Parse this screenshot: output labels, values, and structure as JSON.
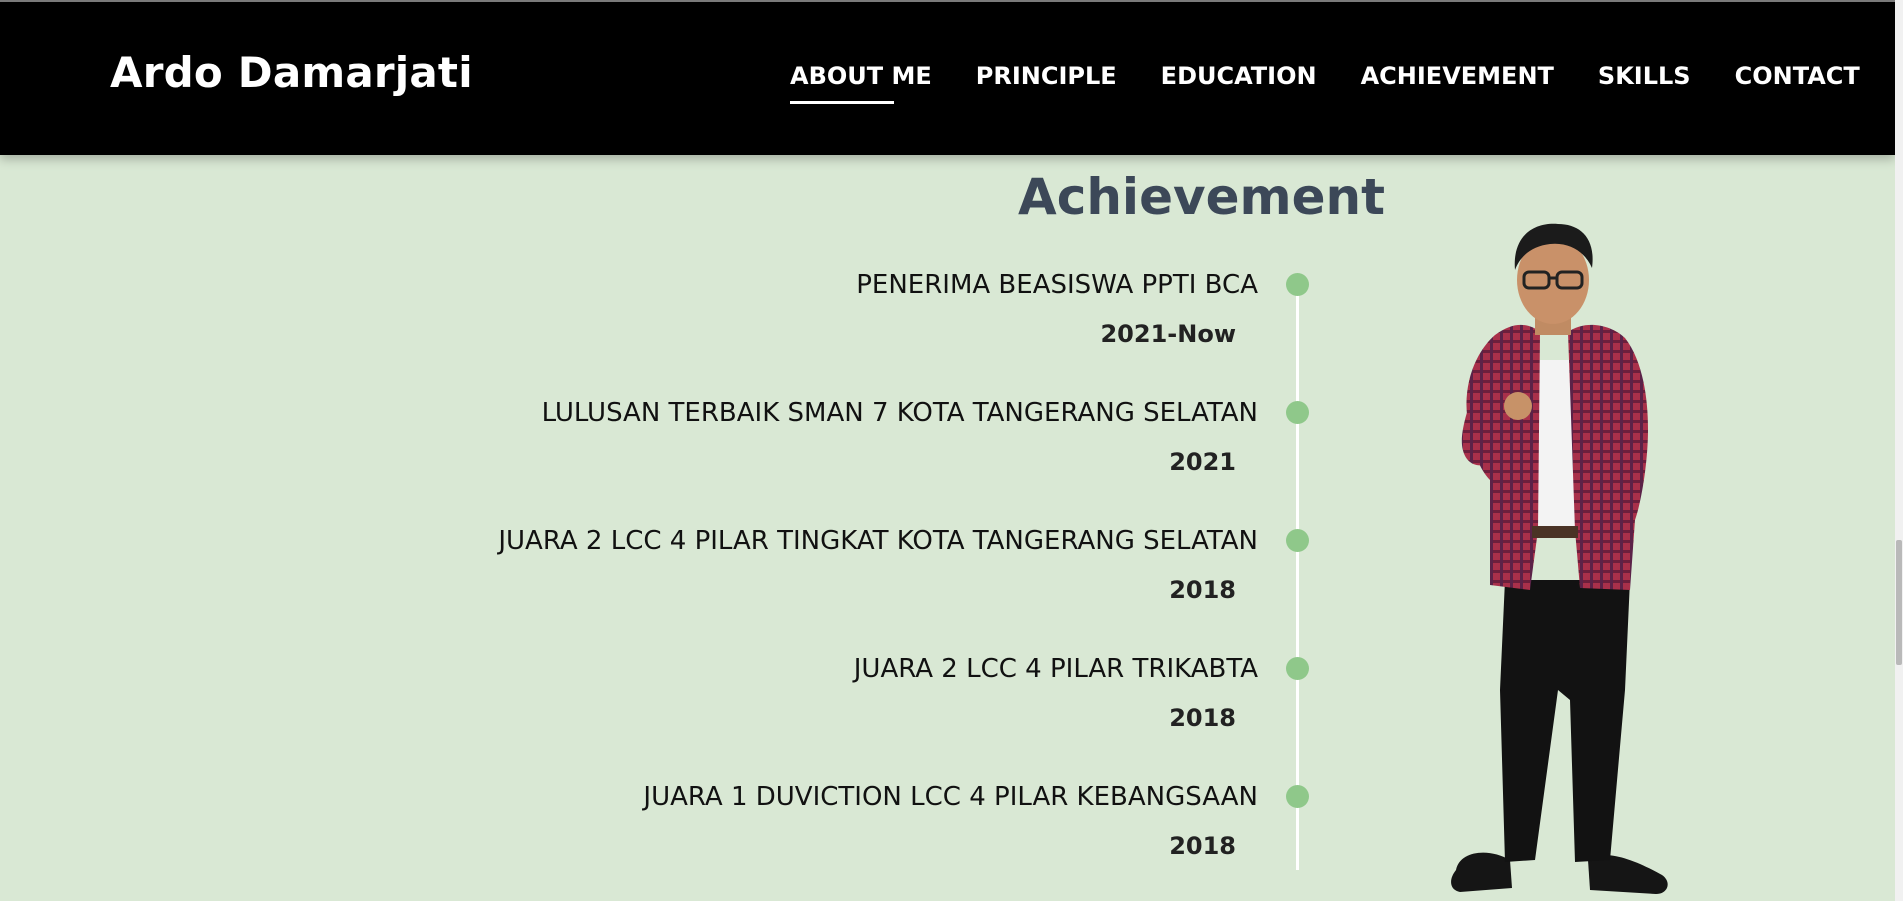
{
  "header": {
    "brand": "Ardo Damarjati",
    "nav": [
      {
        "label": "ABOUT ME",
        "active": true
      },
      {
        "label": "PRINCIPLE",
        "active": false
      },
      {
        "label": "EDUCATION",
        "active": false
      },
      {
        "label": "ACHIEVEMENT",
        "active": false
      },
      {
        "label": "SKILLS",
        "active": false
      },
      {
        "label": "CONTACT",
        "active": false
      }
    ]
  },
  "section": {
    "title": "Achievement"
  },
  "timeline": [
    {
      "title": "PENERIMA BEASISWA PPTI BCA",
      "year": "2021-Now"
    },
    {
      "title": "LULUSAN TERBAIK SMAN 7 KOTA TANGERANG SELATAN",
      "year": "2021"
    },
    {
      "title": "JUARA 2 LCC 4 PILAR TINGKAT KOTA TANGERANG SELATAN",
      "year": "2018"
    },
    {
      "title": "JUARA 2 LCC 4 PILAR TRIKABTA",
      "year": "2018"
    },
    {
      "title": "JUARA 1 DUVICTION LCC 4 PILAR KEBANGSAAN",
      "year": "2018"
    }
  ],
  "colors": {
    "background": "#d9e8d4",
    "navbar": "#000000",
    "accent_dot": "#8fc88a",
    "title": "#3c4858"
  }
}
